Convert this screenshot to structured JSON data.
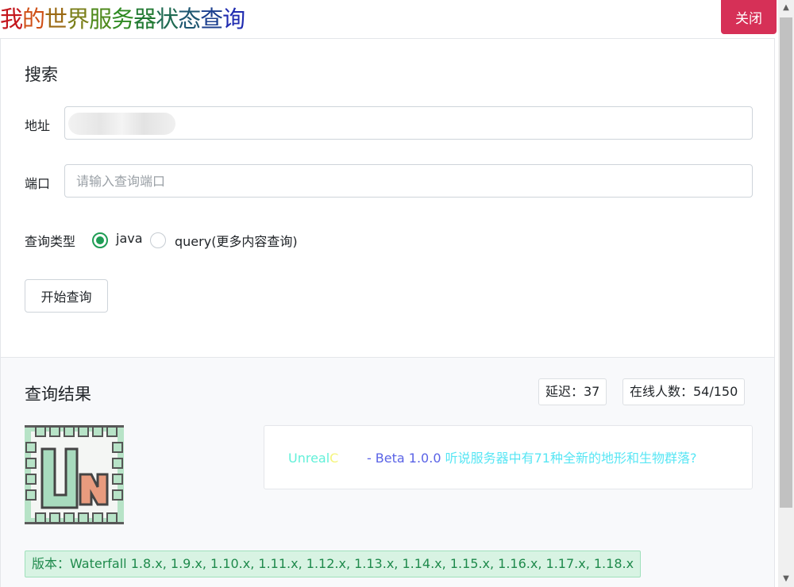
{
  "header": {
    "title_chars": [
      {
        "char": "我",
        "color": "#c4161c"
      },
      {
        "char": "的",
        "color": "#cf4f16"
      },
      {
        "char": "世",
        "color": "#9b6a14"
      },
      {
        "char": "界",
        "color": "#7b7f1a"
      },
      {
        "char": "服",
        "color": "#4f8a1c"
      },
      {
        "char": "务",
        "color": "#2f8a22"
      },
      {
        "char": "器",
        "color": "#227a33"
      },
      {
        "char": "状",
        "color": "#1f6a52"
      },
      {
        "char": "态",
        "color": "#1d5670"
      },
      {
        "char": "查",
        "color": "#1c3f8e"
      },
      {
        "char": "询",
        "color": "#1f2bb0"
      }
    ],
    "close_label": "关闭"
  },
  "search": {
    "title": "搜索",
    "address_label": "地址",
    "address_value": "",
    "port_label": "端口",
    "port_placeholder": "请输入查询端口",
    "type_label": "查询类型",
    "type_options": [
      {
        "label": "java",
        "selected": true
      },
      {
        "label": "query(更多内容查询)",
        "selected": false
      }
    ],
    "submit_label": "开始查询"
  },
  "result": {
    "title": "查询结果",
    "latency_text": "延迟：37",
    "online_text": "在线人数：54/150",
    "motd": {
      "part1": "Unreal",
      "part2": "C",
      "part3": "       - Beta 1.0.0 ",
      "part4": "听说服务器中有71种全新的地形和生物群落?"
    },
    "version_text": "版本：Waterfall 1.8.x, 1.9.x, 1.10.x, 1.11.x, 1.12.x, 1.13.x, 1.14.x, 1.15.x, 1.16.x, 1.17.x, 1.18.x"
  },
  "colors": {
    "close_button": "#d63057",
    "radio_checked": "#1f9d55",
    "version_badge_bg": "#d8f3e3",
    "version_badge_text": "#1f8a4c"
  }
}
